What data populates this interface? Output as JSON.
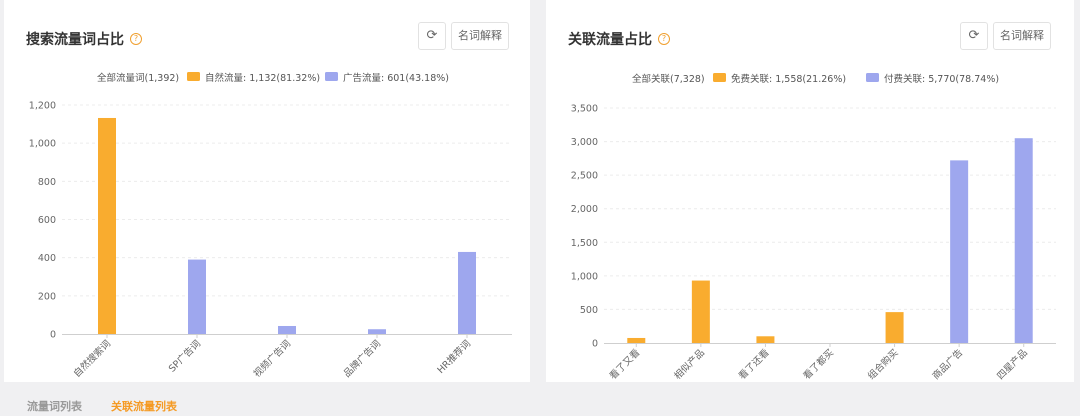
{
  "panels": [
    {
      "title": "搜索流量词占比",
      "help_icon": "?",
      "refresh_icon": "⟳",
      "term_button": "名词解释",
      "legend": {
        "total": "全部流量词(1,392)",
        "items": [
          {
            "label": "自然流量: 1,132(81.32%)",
            "color": "#f9ac2f"
          },
          {
            "label": "广告流量: 601(43.18%)",
            "color": "#9ea7ee"
          }
        ]
      }
    },
    {
      "title": "关联流量占比",
      "help_icon": "?",
      "refresh_icon": "⟳",
      "term_button": "名词解释",
      "legend": {
        "total": "全部关联(7,328)",
        "items": [
          {
            "label": "免费关联: 1,558(21.26%)",
            "color": "#f9ac2f"
          },
          {
            "label": "付费关联: 5,770(78.74%)",
            "color": "#9ea7ee"
          }
        ]
      }
    }
  ],
  "tabs": [
    {
      "label": "流量词列表",
      "active": false
    },
    {
      "label": "关联流量列表",
      "active": true
    }
  ],
  "chart_data": [
    {
      "type": "bar",
      "categories": [
        "自然搜索词",
        "SP广告词",
        "视频广告词",
        "品牌广告词",
        "HR推荐词"
      ],
      "yticks": [
        "0",
        "200",
        "400",
        "600",
        "800",
        "1,000",
        "1,200"
      ],
      "ylim": [
        0,
        1200
      ],
      "values": [
        1132,
        390,
        42,
        25,
        430
      ],
      "colors": [
        "#f9ac2f",
        "#9ea7ee",
        "#9ea7ee",
        "#9ea7ee",
        "#9ea7ee"
      ],
      "grid": true
    },
    {
      "type": "bar",
      "categories": [
        "看了又看",
        "相似产品",
        "看了还看",
        "看了都买",
        "组合购买",
        "商品广告",
        "四星产品"
      ],
      "yticks": [
        "0",
        "500",
        "1,000",
        "1,500",
        "2,000",
        "2,500",
        "3,000",
        "3,500"
      ],
      "ylim": [
        0,
        3500
      ],
      "values": [
        75,
        930,
        100,
        0,
        460,
        2720,
        3050
      ],
      "colors": [
        "#f9ac2f",
        "#f9ac2f",
        "#f9ac2f",
        "#f9ac2f",
        "#f9ac2f",
        "#9ea7ee",
        "#9ea7ee"
      ],
      "grid": true
    }
  ]
}
